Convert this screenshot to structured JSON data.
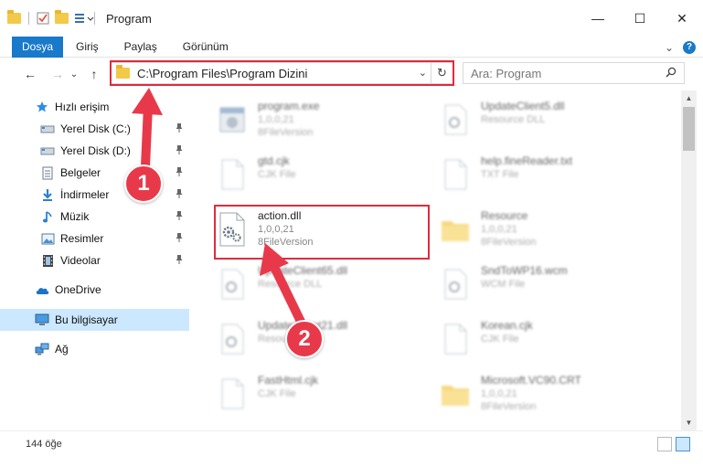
{
  "window": {
    "title": "Program",
    "minimize": "—",
    "maximize": "☐",
    "close": "✕"
  },
  "ribbon": {
    "file_tab": "Dosya",
    "tabs": [
      "Giriş",
      "Paylaş",
      "Görünüm"
    ],
    "expand": "⌄",
    "help": "?"
  },
  "nav": {
    "back": "←",
    "forward": "→",
    "recent": "⌄",
    "up": "↑"
  },
  "address": {
    "path": "C:\\Program Files\\Program Dizini",
    "dropdown": "⌄",
    "refresh": "↻"
  },
  "search": {
    "placeholder": "Ara: Program"
  },
  "sidebar": {
    "items": [
      {
        "label": "Hızlı erişim"
      },
      {
        "label": "Yerel Disk (C:)"
      },
      {
        "label": "Yerel Disk (D:)"
      },
      {
        "label": "Belgeler"
      },
      {
        "label": "İndirmeler"
      },
      {
        "label": "Müzik"
      },
      {
        "label": "Resimler"
      },
      {
        "label": "Videolar"
      },
      {
        "label": "OneDrive"
      },
      {
        "label": "Bu bilgisayar"
      },
      {
        "label": "Ağ"
      }
    ]
  },
  "files": [
    {
      "name": "program.exe",
      "line1": "1,0,0,21",
      "line2": "8FileVersion"
    },
    {
      "name": "gtd.cjk",
      "line1": "CJK File",
      "line2": ""
    },
    {
      "name": "action.dll",
      "line1": "1,0,0,21",
      "line2": "8FileVersion"
    },
    {
      "name": "UpdateClient65.dll",
      "line1": "Resource DLL",
      "line2": ""
    },
    {
      "name": "UpdateClient21.dll",
      "line1": "Resource DLL",
      "line2": ""
    },
    {
      "name": "FastHtml.cjk",
      "line1": "CJK File",
      "line2": ""
    },
    {
      "name": "UpdateClient5.dll",
      "line1": "Resource DLL",
      "line2": ""
    },
    {
      "name": "help.fineReader.txt",
      "line1": "TXT File",
      "line2": ""
    },
    {
      "name": "Resource",
      "line1": "1,0,0,21",
      "line2": "8FileVersion"
    },
    {
      "name": "SndToWP16.wcm",
      "line1": "WCM File",
      "line2": ""
    },
    {
      "name": "Korean.cjk",
      "line1": "CJK File",
      "line2": ""
    },
    {
      "name": "Microsoft.VC90.CRT",
      "line1": "1,0,0,21",
      "line2": "8FileVersion"
    }
  ],
  "status": {
    "count": "144 öğe"
  },
  "annotations": {
    "step1": "1",
    "step2": "2"
  },
  "colors": {
    "accent": "#1979ca",
    "highlight": "#e02b3c",
    "annotation": "#e8394a",
    "selected": "#cce8ff"
  }
}
